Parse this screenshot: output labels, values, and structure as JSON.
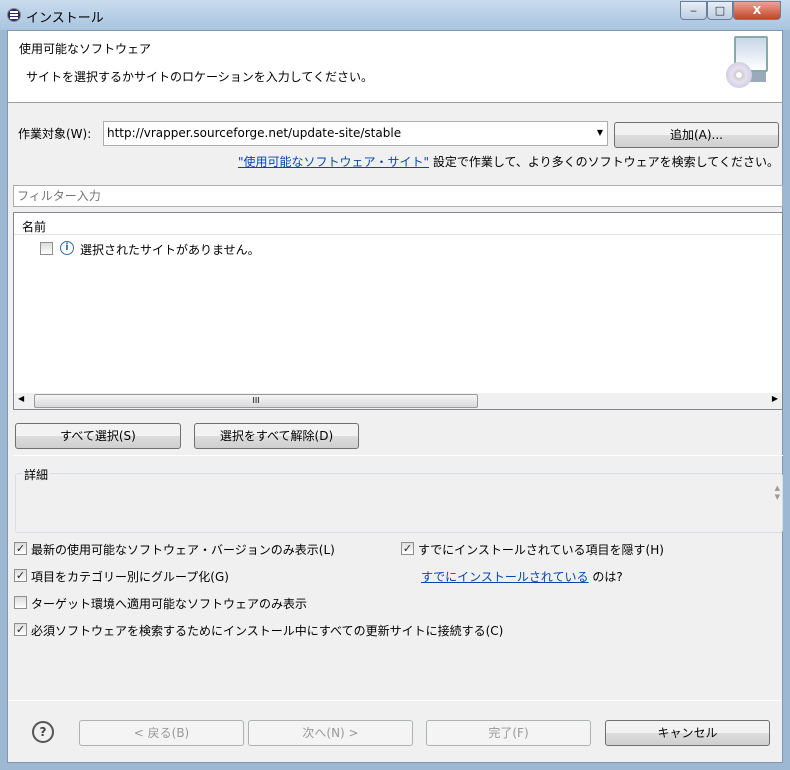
{
  "window": {
    "title": "インストール",
    "minimize": "‒",
    "maximize": "□",
    "close": "X"
  },
  "header": {
    "title": "使用可能なソフトウェア",
    "description": "サイトを選択するかサイトのロケーションを入力してください。"
  },
  "work_with": {
    "label": "作業対象(W):",
    "value": "http://vrapper.sourceforge.net/update-site/stable",
    "add_button": "追加(A)...",
    "link": "\"使用可能なソフトウェア・サイト\"",
    "link_suffix": " 設定で作業して、より多くのソフトウェアを検索してください。"
  },
  "filter": {
    "placeholder": "フィルター入力"
  },
  "table": {
    "column": "名前",
    "rows": [
      {
        "checked": false,
        "text": "選択されたサイトがありません。"
      }
    ],
    "scroll_grip": "III"
  },
  "buttons": {
    "select_all": "すべて選択(S)",
    "deselect_all": "選択をすべて解除(D)"
  },
  "details": {
    "label": "詳細"
  },
  "options": [
    {
      "label": "最新の使用可能なソフトウェア・バージョンのみ表示(L)",
      "checked": true
    },
    {
      "label": "すでにインストールされている項目を隠す(H)",
      "checked": true
    },
    {
      "label": "項目をカテゴリー別にグループ化(G)",
      "checked": true
    },
    {
      "label": "ターゲット環境へ適用可能なソフトウェアのみ表示",
      "checked": false
    },
    {
      "label": "必須ソフトウェアを検索するためにインストール中にすべての更新サイトに接続する(C)",
      "checked": true
    }
  ],
  "installed_link": {
    "link": "すでにインストールされている",
    "suffix": " のは?"
  },
  "footer": {
    "help": "?",
    "back": "< 戻る(B)",
    "next": "次へ(N) >",
    "finish": "完了(F)",
    "cancel": "キャンセル"
  }
}
